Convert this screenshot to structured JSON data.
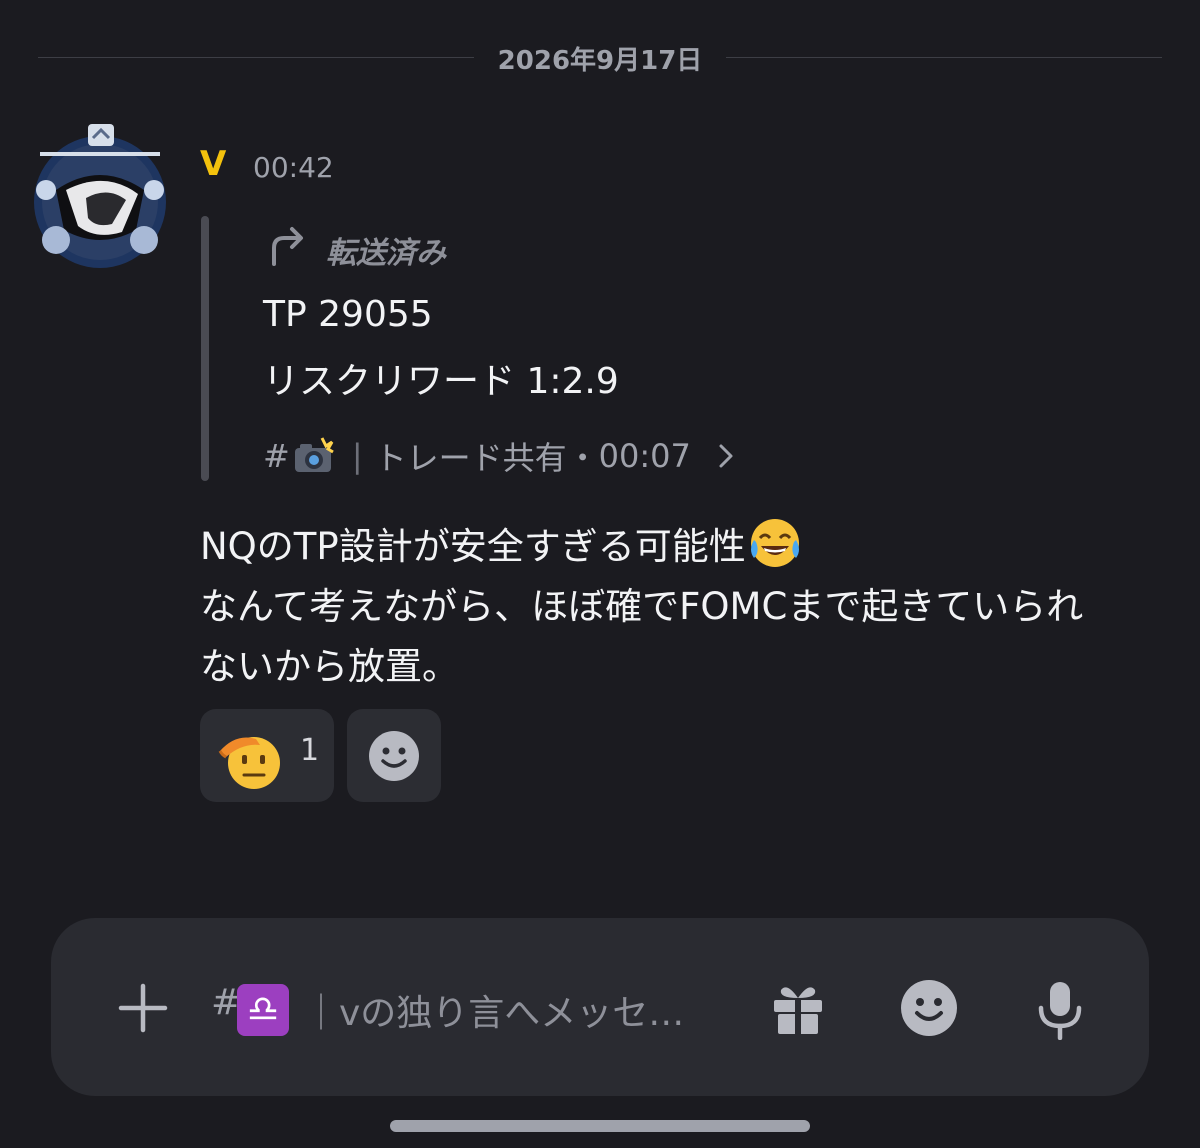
{
  "date_divider": "2026年9月17日",
  "message": {
    "author": "V",
    "author_color": "#f4c20d",
    "time": "00:42",
    "avatar_icon": "libra-avatar",
    "forwarded": {
      "label": "転送済み",
      "lines": [
        "TP 29055",
        "リスクリワード 1:2.9"
      ],
      "source": {
        "hash": "#",
        "channel_icon": "camera-flash-emoji",
        "separator": "|",
        "channel_name": "トレード共有",
        "dot": "・",
        "time": "00:07"
      }
    },
    "body_lines": [
      "NQのTP設計が安全すぎる可能性",
      "なんて考えながら、ほぼ確でFOMCまで起きていられ",
      "ないから放置。"
    ],
    "body_emoji": "tears-of-joy-emoji",
    "reactions": [
      {
        "emoji": "saluting-face-emoji",
        "count": "1"
      }
    ],
    "add_reaction_icon": "add-reaction-icon"
  },
  "composer": {
    "hash": "#",
    "channel_emoji": "♎",
    "placeholder": "｜vの独り言へメッセ…"
  },
  "colors": {
    "background": "#1b1b20",
    "composer": "#2a2b31",
    "reaction_bg": "#2c2d33",
    "libra_badge": "#9c3fc0"
  }
}
